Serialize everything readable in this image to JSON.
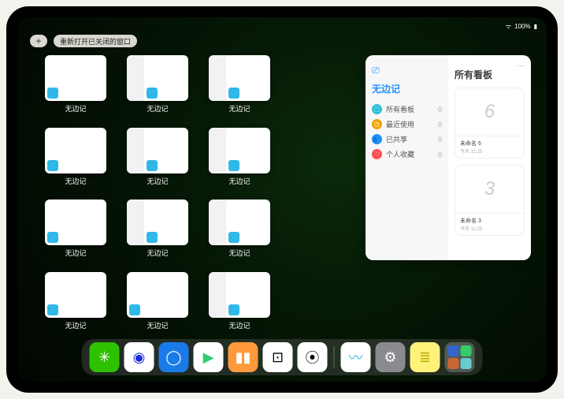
{
  "statusbar": {
    "battery": "100%"
  },
  "topbar": {
    "plus": "+",
    "reopen_label": "重新打开已关闭的窗口"
  },
  "app_label": "无边记",
  "thumbs": [
    {
      "type": "blank"
    },
    {
      "type": "sidebar"
    },
    {
      "type": "sidebar"
    },
    {
      "type": "empty"
    },
    {
      "type": "blank"
    },
    {
      "type": "sidebar"
    },
    {
      "type": "sidebar"
    },
    {
      "type": "empty"
    },
    {
      "type": "blank"
    },
    {
      "type": "sidebar"
    },
    {
      "type": "sidebar"
    },
    {
      "type": "empty"
    },
    {
      "type": "blank"
    },
    {
      "type": "blank"
    },
    {
      "type": "sidebar"
    },
    {
      "type": "empty"
    }
  ],
  "panel": {
    "left_title": "无边记",
    "right_title": "所有看板",
    "more": "…",
    "categories": [
      {
        "label": "所有看板",
        "count": "0",
        "color": "#2cc0d6",
        "glyph": "⬚"
      },
      {
        "label": "最近使用",
        "count": "0",
        "color": "#f4a300",
        "glyph": "◷"
      },
      {
        "label": "已共享",
        "count": "0",
        "color": "#1e90ff",
        "glyph": "👥"
      },
      {
        "label": "个人收藏",
        "count": "0",
        "color": "#ff4d4f",
        "glyph": "♡"
      }
    ],
    "boards": [
      {
        "name": "未命名 6",
        "date": "今天 11:25",
        "glyph": "6"
      },
      {
        "name": "未命名 3",
        "date": "今天 11:25",
        "glyph": "3"
      }
    ]
  },
  "dock": {
    "icons": [
      {
        "name": "wechat",
        "bg": "#2dc100",
        "glyph": "✳"
      },
      {
        "name": "quark-hd",
        "bg": "#ffffff",
        "fg": "#1a2bd8",
        "glyph": "◉"
      },
      {
        "name": "quark",
        "bg": "#1a7be8",
        "glyph": "◯"
      },
      {
        "name": "video",
        "bg": "#ffffff",
        "fg": "#2ecc71",
        "glyph": "▶"
      },
      {
        "name": "books",
        "bg": "#ff9a3c",
        "glyph": "▮▮"
      },
      {
        "name": "cube",
        "bg": "#ffffff",
        "fg": "#000",
        "glyph": "⊡"
      },
      {
        "name": "share",
        "bg": "#ffffff",
        "fg": "#000",
        "glyph": "⦿"
      }
    ],
    "recent": [
      {
        "name": "freeform",
        "bg": "#ffffff",
        "fg": "#2fb8e8",
        "glyph": "〰"
      },
      {
        "name": "settings",
        "bg": "#8b8b8f",
        "glyph": "⚙"
      },
      {
        "name": "notes",
        "bg": "#fff27a",
        "fg": "#bba800",
        "glyph": "≣"
      }
    ],
    "folder_colors": [
      "#36c",
      "#3c6",
      "#c63",
      "#6cc"
    ]
  }
}
